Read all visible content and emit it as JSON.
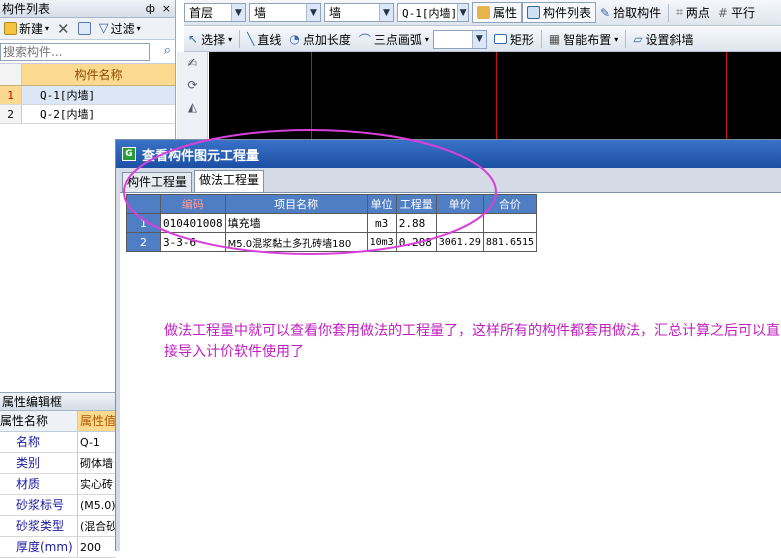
{
  "left_panel": {
    "title": "构件列表",
    "pin_glyph": "ф",
    "close_glyph": "×",
    "toolbar": {
      "new_label": "新建",
      "filter_label": "过滤"
    },
    "search_placeholder": "搜索构件...",
    "grid_header": "构件名称",
    "rows": [
      {
        "num": "1",
        "name": "Q-1[内墙]"
      },
      {
        "num": "2",
        "name": "Q-2[内墙]"
      }
    ]
  },
  "property_panel": {
    "title": "属性编辑框",
    "col_name": "属性名称",
    "col_value": "属性值",
    "rows": [
      {
        "name": "名称",
        "value": "Q-1"
      },
      {
        "name": "类别",
        "value": "砌体墙"
      },
      {
        "name": "材质",
        "value": "实心砖"
      },
      {
        "name": "砂浆标号",
        "value": "(M5.0)"
      },
      {
        "name": "砂浆类型",
        "value": "(混合砂"
      },
      {
        "name": "厚度(mm)",
        "value": "200"
      }
    ]
  },
  "toolbar1": {
    "floor": "首层",
    "category": "墙",
    "type": "墙",
    "component": "Q-1[内墙]",
    "properties_label": "属性",
    "component_list_label": "构件列表",
    "pick_label": "拾取构件",
    "two_points_label": "两点",
    "parallel_label": "平行"
  },
  "toolbar2": {
    "select_label": "选择",
    "line_label": "直线",
    "point_length_label": "点加长度",
    "arc_label": "三点画弧",
    "rect_label": "矩形",
    "smart_layout_label": "智能布置",
    "slope_wall_label": "设置斜墙"
  },
  "dialog": {
    "title": "查看构件图元工程量",
    "tabs": [
      "构件工程量",
      "做法工程量"
    ],
    "active_tab": 1,
    "table": {
      "headers": [
        "编码",
        "项目名称",
        "单位",
        "工程量",
        "单价",
        "合价"
      ],
      "rows": [
        {
          "num": "1",
          "code": "010401008",
          "name": "填充墙",
          "unit": "m3",
          "qty": "2.88",
          "price": "",
          "total": ""
        },
        {
          "num": "2",
          "code": "3-3-6",
          "name": "M5.0混浆黏土多孔砖墙180",
          "unit": "10m3",
          "qty": "0.288",
          "price": "3061.29",
          "total": "881.6515"
        }
      ]
    },
    "annotation": "做法工程量中就可以查看你套用做法的工程量了，这样所有的构件都套用做法，汇总计算之后可以直接导入计价软件使用了"
  },
  "colors": {
    "annotation": "#c020c0",
    "highlight_ellipse": "#d940d9",
    "header_gold": "#fbd98f",
    "table_header_blue": "#4f7ec4",
    "canvas": "#000000",
    "axis_red": "#cc1111"
  },
  "icons": [
    "new-icon",
    "delete-icon",
    "copy-icon",
    "filter-icon",
    "search-icon",
    "properties-icon",
    "list-icon",
    "pick-icon",
    "two-points-icon",
    "parallel-icon",
    "select-icon",
    "line-icon",
    "point-length-icon",
    "arc-icon",
    "rect-icon",
    "smart-layout-icon",
    "slope-wall-icon",
    "app-icon"
  ]
}
